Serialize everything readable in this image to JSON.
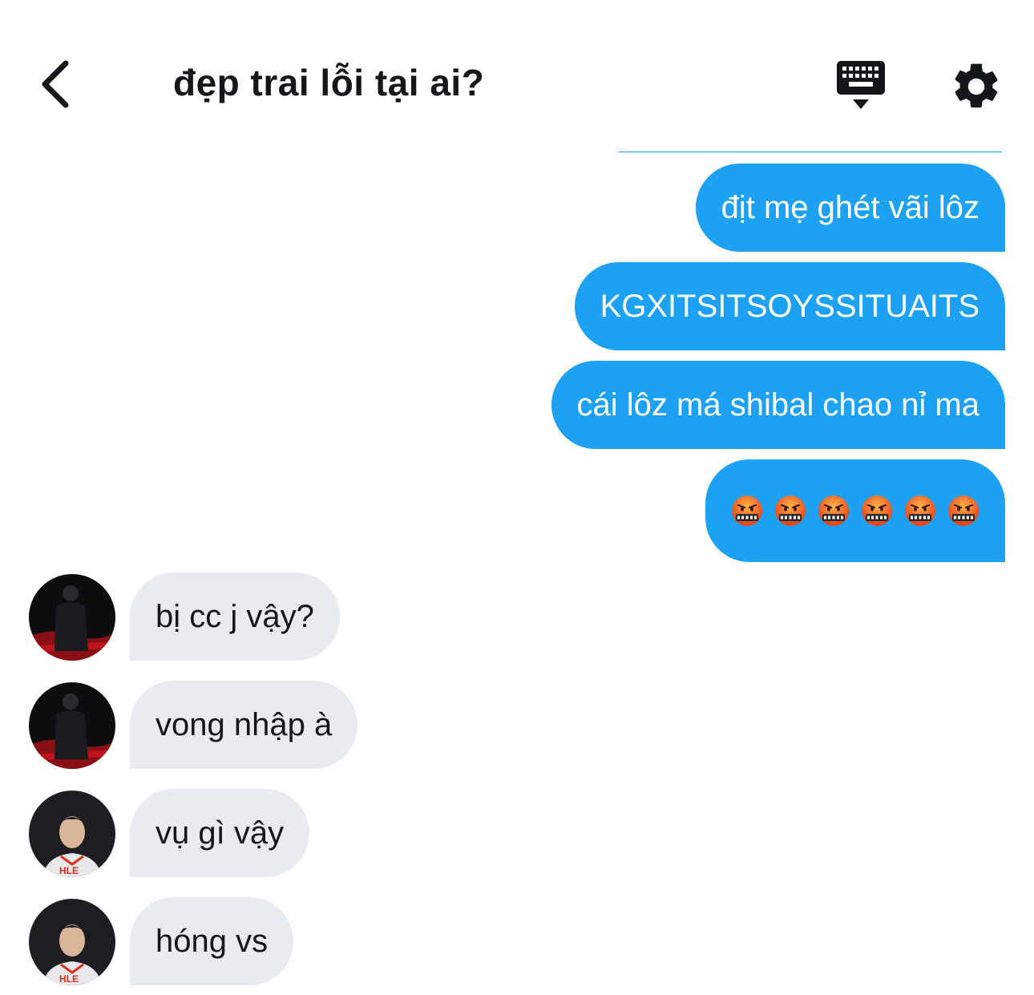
{
  "header": {
    "title": "đẹp trai lỗi tại ai?",
    "back_icon": "chevron-left-icon",
    "keyboard_icon": "keyboard-icon",
    "settings_icon": "gear-icon"
  },
  "colors": {
    "outgoing_bubble": "#1da1f2",
    "incoming_bubble": "#e6ecf0",
    "text_dark": "#14171a"
  },
  "messages": {
    "outgoing": [
      {
        "text": "địt mẹ ghét vãi lôz"
      },
      {
        "text": "KGXITSITSOYSSITUAITS"
      },
      {
        "text": "cái lôz má shibal chao nỉ ma"
      },
      {
        "emoji": "face-with-symbols-on-mouth",
        "count": 6
      }
    ],
    "incoming": [
      {
        "text": "bị cc j vậy?",
        "avatar": "user-avatar-dark"
      },
      {
        "text": "vong nhập à",
        "avatar": "user-avatar-dark"
      },
      {
        "text": "vụ gì vậy",
        "avatar": "user-avatar-hle"
      },
      {
        "text": "hóng vs",
        "avatar": "user-avatar-hle"
      }
    ]
  }
}
